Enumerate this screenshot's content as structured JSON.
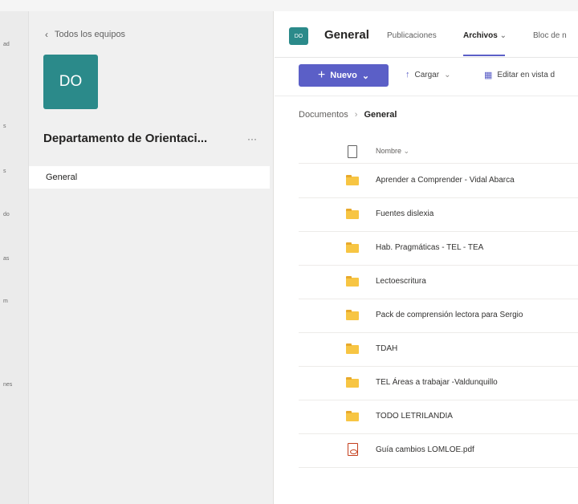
{
  "rail": {
    "items": [
      "ad",
      "s",
      "s",
      "do",
      "as",
      "m",
      "nes"
    ]
  },
  "team": {
    "back_label": "Todos los equipos",
    "avatar_initials": "DO",
    "name": "Departamento de Orientaci...",
    "more": "···",
    "channels": [
      "General"
    ]
  },
  "channel_header": {
    "avatar_initials": "DO",
    "title": "General",
    "tabs": [
      "Publicaciones",
      "Archivos",
      "Bloc de n"
    ],
    "active_tab": "Archivos"
  },
  "toolbar": {
    "new_label": "Nuevo",
    "upload_label": "Cargar",
    "edit_grid_label": "Editar en vista d"
  },
  "breadcrumb": {
    "root": "Documentos",
    "current": "General"
  },
  "files": {
    "column_name": "Nombre",
    "rows": [
      {
        "name": "Aprender a Comprender - Vidal Abarca",
        "type": "folder"
      },
      {
        "name": "Fuentes dislexia",
        "type": "folder"
      },
      {
        "name": "Hab. Pragmáticas - TEL - TEA",
        "type": "folder"
      },
      {
        "name": "Lectoescritura",
        "type": "folder"
      },
      {
        "name": "Pack de comprensión lectora para Sergio",
        "type": "folder"
      },
      {
        "name": "TDAH",
        "type": "folder"
      },
      {
        "name": "TEL Áreas a trabajar -Valdunquillo",
        "type": "folder"
      },
      {
        "name": "TODO LETRILANDIA",
        "type": "folder"
      },
      {
        "name": "Guía cambios LOMLOE.pdf",
        "type": "pdf"
      }
    ]
  },
  "colors": {
    "accent": "#5b5fc7",
    "team_avatar": "#2b8a8a",
    "folder": "#f7c543"
  }
}
